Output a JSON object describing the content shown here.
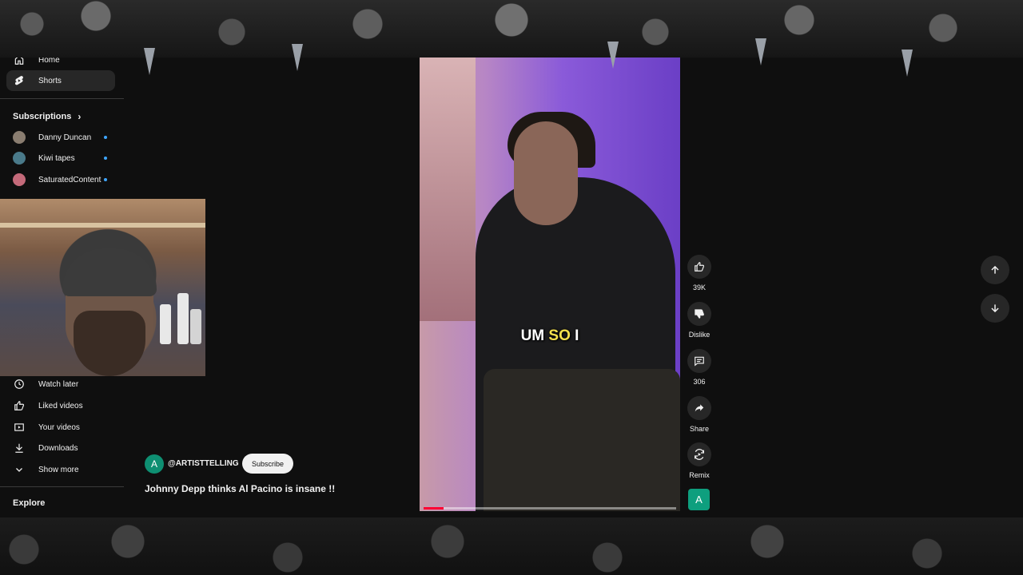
{
  "sidebar": {
    "home_label": "Home",
    "shorts_label": "Shorts",
    "subscriptions_label": "Subscriptions",
    "subscriptions": [
      {
        "name": "Danny Duncan",
        "avatar_color": "#8a7d70"
      },
      {
        "name": "Kiwi tapes",
        "avatar_color": "#4a7a8a"
      },
      {
        "name": "SaturatedContent",
        "avatar_color": "#c46a7a"
      }
    ],
    "library": [
      {
        "label": "Watch later",
        "icon": "clock-icon"
      },
      {
        "label": "Liked videos",
        "icon": "thumbs-up-icon"
      },
      {
        "label": "Your videos",
        "icon": "play-square-icon"
      },
      {
        "label": "Downloads",
        "icon": "download-icon"
      },
      {
        "label": "Show more",
        "icon": "chevron-down-icon"
      }
    ],
    "explore_label": "Explore"
  },
  "short": {
    "caption_word1": "UM",
    "caption_word2": "SO",
    "caption_word3": "I",
    "progress_percent": 8,
    "channel_avatar_letter": "A",
    "channel_handle": "@ARTISTTELLING",
    "subscribe_label": "Subscribe",
    "title": "Johnny Depp thinks Al Pacino is insane !!"
  },
  "actions": {
    "like_count": "39K",
    "dislike_label": "Dislike",
    "comment_count": "306",
    "share_label": "Share",
    "remix_label": "Remix",
    "channel_tile_letter": "A"
  },
  "colors": {
    "background": "#0f0f0f",
    "accent_red": "#ff0033",
    "caption_highlight": "#f4e04d",
    "channel_green": "#0e9f7e"
  }
}
